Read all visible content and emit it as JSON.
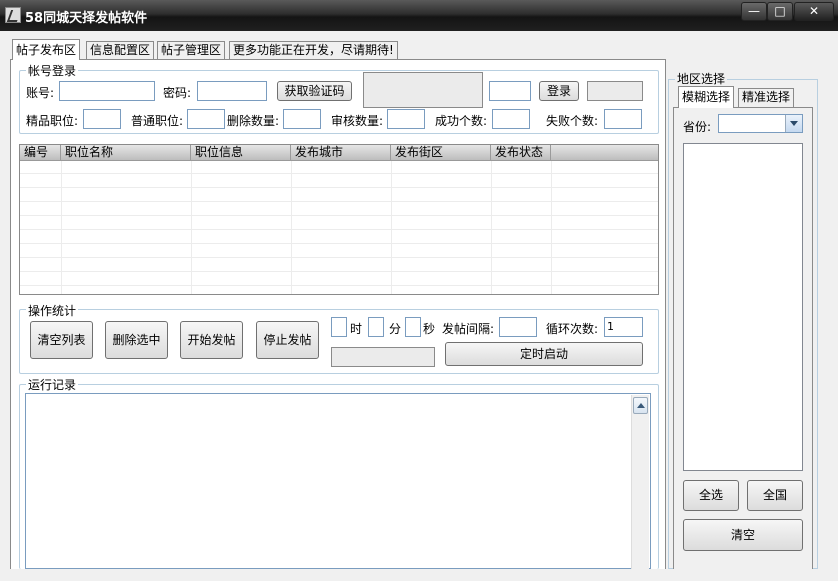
{
  "window": {
    "title": "58同城天择发帖软件",
    "min_label": "—",
    "max_label": "□",
    "close_label": "✕"
  },
  "tabs": [
    "帖子发布区",
    "信息配置区",
    "帖子管理区",
    "更多功能正在开发，尽请期待!"
  ],
  "login": {
    "group_label": "帐号登录",
    "account_label": "账号:",
    "password_label": "密码:",
    "captcha_button": "获取验证码",
    "login_button": "登录",
    "premium_label": "精品职位:",
    "normal_label": "普通职位:",
    "delete_label": "删除数量:",
    "review_label": "审核数量:",
    "success_label": "成功个数:",
    "fail_label": "失败个数:"
  },
  "table": {
    "columns": [
      "编号",
      "职位名称",
      "职位信息",
      "发布城市",
      "发布街区",
      "发布状态"
    ],
    "rows": []
  },
  "ops": {
    "group_label": "操作统计",
    "clear_list": "清空列表",
    "delete_selected": "删除选中",
    "start_post": "开始发帖",
    "stop_post": "停止发帖",
    "hour_label": "时",
    "minute_label": "分",
    "second_label": "秒",
    "interval_label": "发帖间隔:",
    "loop_label": "循环次数:",
    "loop_value": "1",
    "timer_start": "定时启动"
  },
  "log": {
    "group_label": "运行记录"
  },
  "region": {
    "group_label": "地区选择",
    "tabs": [
      "模糊选择",
      "精准选择"
    ],
    "province_label": "省份:",
    "select_all": "全选",
    "nationwide": "全国",
    "clear": "清空"
  }
}
